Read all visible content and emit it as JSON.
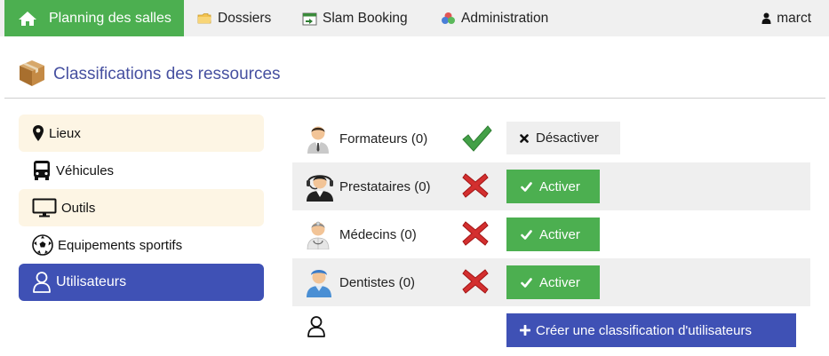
{
  "nav": {
    "home_label": "Planning des salles",
    "dossiers_label": "Dossiers",
    "slam_label": "Slam Booking",
    "admin_label": "Administration",
    "user_label": "marct"
  },
  "header": {
    "title": "Classifications des ressources"
  },
  "sidebar": {
    "items": [
      {
        "label": "Lieux",
        "icon": "map-marker-icon"
      },
      {
        "label": "Véhicules",
        "icon": "bus-icon"
      },
      {
        "label": "Outils",
        "icon": "monitor-icon"
      },
      {
        "label": "Equipements sportifs",
        "icon": "soccer-ball-icon"
      },
      {
        "label": "Utilisateurs",
        "icon": "user-outline-icon"
      }
    ]
  },
  "classifications": [
    {
      "name": "Formateurs (0)",
      "active": true,
      "action": "Désactiver"
    },
    {
      "name": "Prestataires (0)",
      "active": false,
      "action": "Activer"
    },
    {
      "name": "Médecins (0)",
      "active": false,
      "action": "Activer"
    },
    {
      "name": "Dentistes (0)",
      "active": false,
      "action": "Activer"
    }
  ],
  "create_label": "Créer une classification d'utilisateurs",
  "colors": {
    "green": "#4caf50",
    "indigo": "#3f51b5",
    "title": "#4650a0",
    "cross": "#d32f2f",
    "check": "#43a047"
  }
}
